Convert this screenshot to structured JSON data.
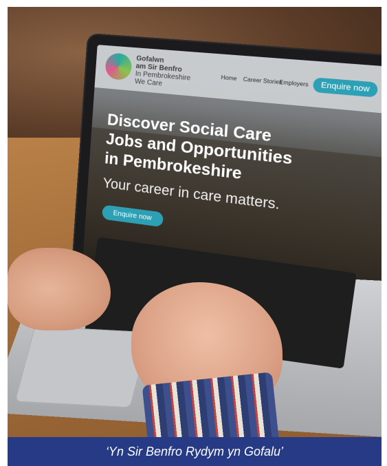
{
  "screen": {
    "logo": {
      "line1": "Gofalwn",
      "line2": "am Sir Benfro",
      "line3": "In Pembrokeshire",
      "line4": "We Care"
    },
    "nav": {
      "items": [
        "Home",
        "Career Stories",
        "Employers"
      ],
      "cta": "Enquire now"
    },
    "hero": {
      "headline_line1": "Discover Social Care",
      "headline_line2": "Jobs and Opportunities",
      "headline_line3": "in Pembrokeshire",
      "subheadline": "Your career in care matters.",
      "cta": "Enquire now"
    }
  },
  "caption": "‘Yn Sir Benfro Rydym yn Gofalu’"
}
